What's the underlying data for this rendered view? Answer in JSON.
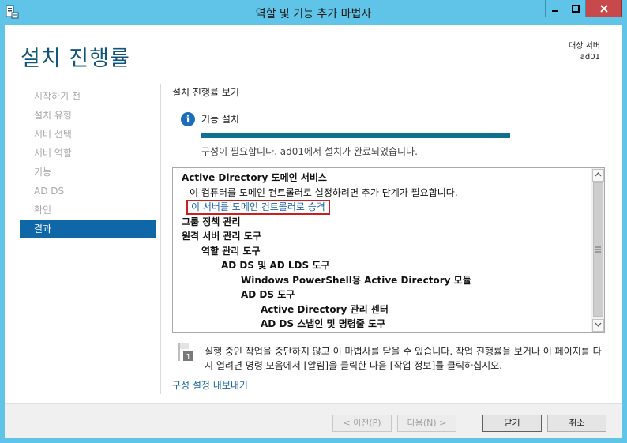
{
  "window": {
    "title": "역할 및 기능 추가 마법사"
  },
  "header": {
    "title": "설치 진행률",
    "target_label": "대상 서버",
    "target_server": "ad01"
  },
  "nav": {
    "items": [
      {
        "label": "시작하기 전",
        "active": false
      },
      {
        "label": "설치 유형",
        "active": false
      },
      {
        "label": "서버 선택",
        "active": false
      },
      {
        "label": "서버 역할",
        "active": false
      },
      {
        "label": "기능",
        "active": false
      },
      {
        "label": "AD DS",
        "active": false
      },
      {
        "label": "확인",
        "active": false
      },
      {
        "label": "결과",
        "active": true
      }
    ]
  },
  "main": {
    "section_title": "설치 진행률 보기",
    "feature_install_label": "기능 설치",
    "progress_fraction": 1.0,
    "status_text": "구성이 필요합니다. ad01에서 설치가 완료되었습니다.",
    "results": {
      "line1": "Active Directory 도메인 서비스",
      "line2": "이 컴퓨터를 도메인 컨트롤러로 설정하려면 추가 단계가 필요합니다.",
      "promote_link": "이 서버를 도메인 컨트롤러로 승격",
      "line4": "그룹 정책 관리",
      "line5": "원격 서버 관리 도구",
      "line6": "역할 관리 도구",
      "line7": "AD DS 및 AD LDS 도구",
      "line8": "Windows PowerShell용 Active Directory 모듈",
      "line9": "AD DS 도구",
      "line10": "Active Directory 관리 센터",
      "line11": "AD DS 스냅인 및 명령줄 도구"
    },
    "note_text": "실행 중인 작업을 중단하지 않고 이 마법사를 닫을 수 있습니다. 작업 진행률을 보거나 이 페이지를 다시 열려면 명령 모음에서 [알림]을 클릭한 다음 [작업 정보]를 클릭하십시오.",
    "export_link": "구성 설정 내보내기"
  },
  "footer": {
    "prev_label": "< 이전(P)",
    "next_label": "다음(N) >",
    "close_label": "닫기",
    "cancel_label": "취소"
  },
  "colors": {
    "titlebar": "#5fc4e7",
    "accent": "#1067a8",
    "progress": "#0f7091",
    "close_button": "#c7494b",
    "highlight_box": "#cc2020"
  }
}
